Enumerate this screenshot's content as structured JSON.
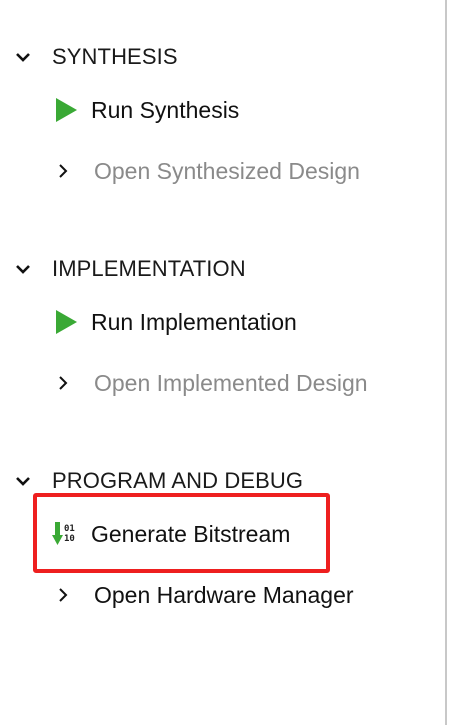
{
  "flow_navigator": {
    "sections": [
      {
        "title": "SYNTHESIS",
        "items": [
          {
            "label": "Run Synthesis",
            "icon": "run-icon",
            "enabled": true
          },
          {
            "label": "Open Synthesized Design",
            "icon": "chevron-right-icon",
            "enabled": false
          }
        ]
      },
      {
        "title": "IMPLEMENTATION",
        "items": [
          {
            "label": "Run Implementation",
            "icon": "run-icon",
            "enabled": true
          },
          {
            "label": "Open Implemented Design",
            "icon": "chevron-right-icon",
            "enabled": false
          }
        ]
      },
      {
        "title": "PROGRAM AND DEBUG",
        "items": [
          {
            "label": "Generate Bitstream",
            "icon": "bitstream-icon",
            "enabled": true,
            "highlighted": true
          },
          {
            "label": "Open Hardware Manager",
            "icon": "chevron-right-icon",
            "enabled": true
          }
        ]
      }
    ]
  },
  "colors": {
    "run_icon": "#3aa935",
    "bitstream_arrow": "#3aa935",
    "highlight": "#ee1f1f",
    "disabled_text": "#8a8a8a",
    "text": "#111111"
  }
}
